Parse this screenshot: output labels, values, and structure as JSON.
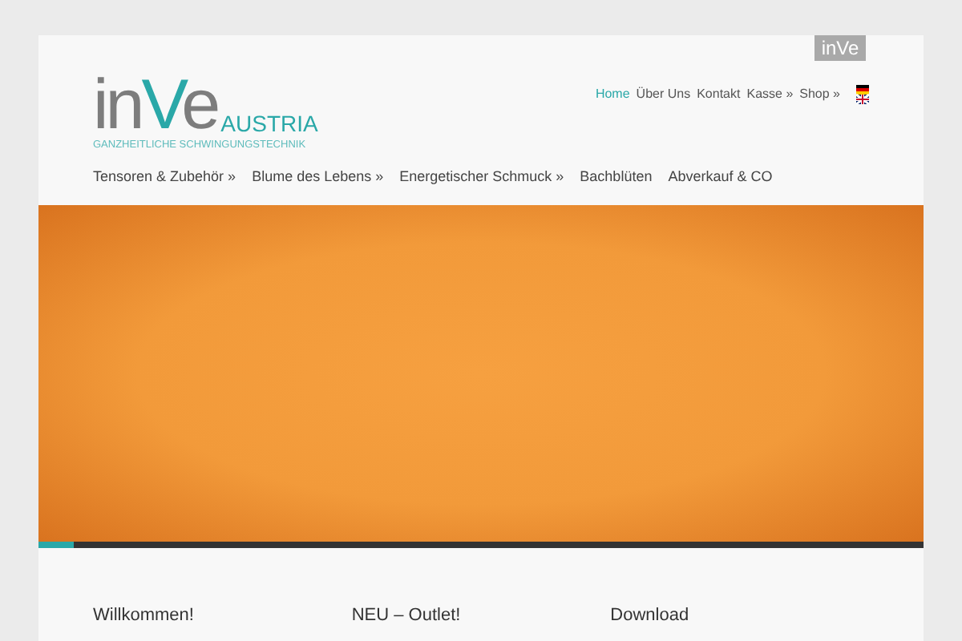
{
  "top_badge": {
    "text": "inVe"
  },
  "logo": {
    "parts": [
      {
        "text": "in",
        "accent": false
      },
      {
        "text": "V",
        "accent": true
      },
      {
        "text": "e",
        "accent": false
      }
    ],
    "country": "AUSTRIA",
    "tagline": "GANZHEITLICHE SCHWINGUNGSTECHNIK"
  },
  "top_nav": [
    {
      "label": "Home",
      "selected": true
    },
    {
      "label": "Über Uns",
      "selected": false
    },
    {
      "label": "Kontakt",
      "selected": false
    },
    {
      "label": "Kasse »",
      "selected": false
    },
    {
      "label": "Shop »",
      "selected": false
    }
  ],
  "main_menu": [
    {
      "label": "Tensoren & Zubehör »"
    },
    {
      "label": "Blume des Lebens »"
    },
    {
      "label": "Energetischer Schmuck »"
    },
    {
      "label": "Bachblüten"
    },
    {
      "label": "Abverkauf & CO"
    }
  ],
  "slider": {
    "level": 0.04
  },
  "columns": [
    {
      "title": "Willkommen!"
    },
    {
      "title": "NEU – Outlet!"
    },
    {
      "title": "Download"
    }
  ]
}
